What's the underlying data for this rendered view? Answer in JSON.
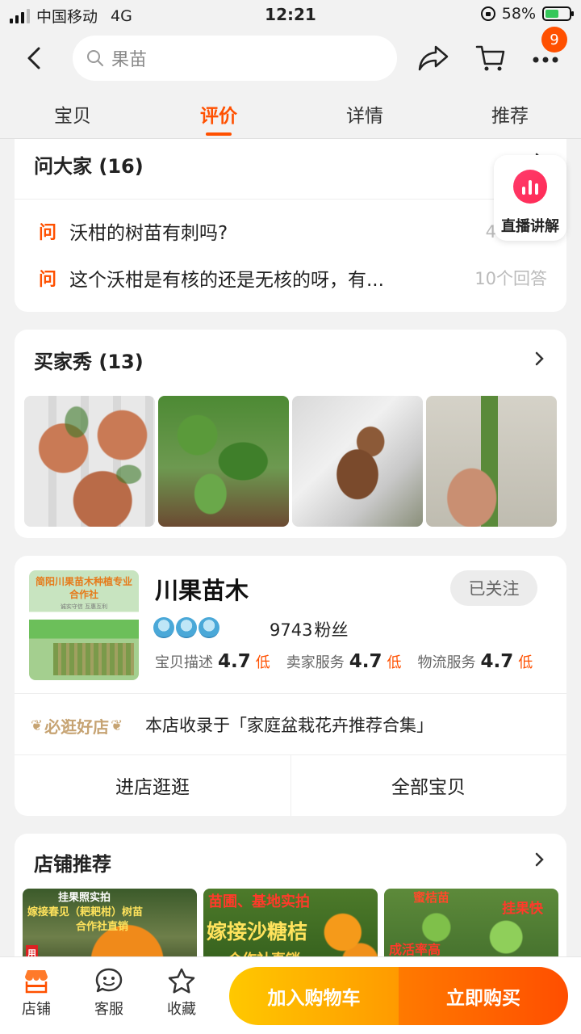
{
  "status_bar": {
    "carrier": "中国移动",
    "network": "4G",
    "time": "12:21",
    "battery": "58%",
    "battery_level": 0.58
  },
  "topbar": {
    "search_placeholder": "果苗",
    "cart_badge": "9"
  },
  "tabs": [
    {
      "label": "宝贝",
      "active": false
    },
    {
      "label": "评价",
      "active": true
    },
    {
      "label": "详情",
      "active": false
    },
    {
      "label": "推荐",
      "active": false
    }
  ],
  "ask": {
    "title": "问大家 (16)",
    "icon_label": "问",
    "questions": [
      {
        "text": "沃柑的树苗有刺吗?",
        "count": "4个回答"
      },
      {
        "text": "这个沃柑是有核的还是无核的呀，有...",
        "count": "10个回答"
      }
    ]
  },
  "live": {
    "label": "直播讲解"
  },
  "buyer_show": {
    "title": "买家秀 (13)"
  },
  "shop": {
    "logo_text": "简阳川果苗木种植专业合作社",
    "logo_sub": "诚实守信 互惠互利",
    "name": "川果苗木",
    "follow_label": "已关注",
    "fans_count": "9743",
    "fans_label": "粉丝",
    "ratings": [
      {
        "label": "宝贝描述",
        "score": "4.7",
        "level": "低"
      },
      {
        "label": "卖家服务",
        "score": "4.7",
        "level": "低"
      },
      {
        "label": "物流服务",
        "score": "4.7",
        "level": "低"
      }
    ],
    "good_shop_badge": "必逛好店",
    "collection_text": "本店收录于「家庭盆栽花卉推荐合集」",
    "enter_shop": "进店逛逛",
    "all_items": "全部宝贝"
  },
  "recommend": {
    "title": "店铺推荐",
    "items": [
      {
        "lines": [
          "挂果照实拍",
          "嫁接春见（耙耙柑）树苗",
          "合作社直销",
          "用"
        ]
      },
      {
        "lines": [
          "苗圃、基地实拍",
          "嫁接沙糖桔",
          "合作社直销"
        ]
      },
      {
        "lines": [
          "蜜桔苗",
          "挂果快",
          "成活率高"
        ]
      }
    ]
  },
  "bottom_bar": {
    "shop": "店铺",
    "service": "客服",
    "favorite": "收藏",
    "add_cart": "加入购物车",
    "buy_now": "立即购买"
  },
  "colors": {
    "accent": "#ff5000",
    "cart_button": "#ffb400",
    "buy_button": "#ff5a00"
  }
}
